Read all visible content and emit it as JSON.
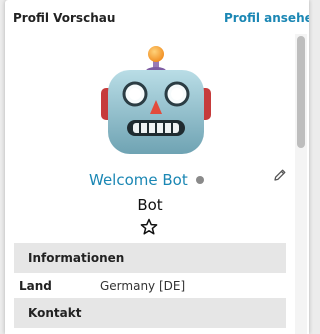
{
  "header": {
    "title": "Profil Vorschau",
    "view_profile_link": "Profil ansehen"
  },
  "profile": {
    "display_name": "Welcome Bot",
    "username": "Bot",
    "status": "offline",
    "avatar_icon": "robot-face-icon"
  },
  "sections": {
    "info_heading": "Informationen",
    "contact_heading": "Kontakt"
  },
  "info_rows": [
    {
      "label": "Land",
      "value": "Germany [DE]"
    }
  ],
  "colors": {
    "accent": "#1b87b4",
    "status_offline": "#8a8a8a",
    "section_bg": "#e6e6e6"
  }
}
